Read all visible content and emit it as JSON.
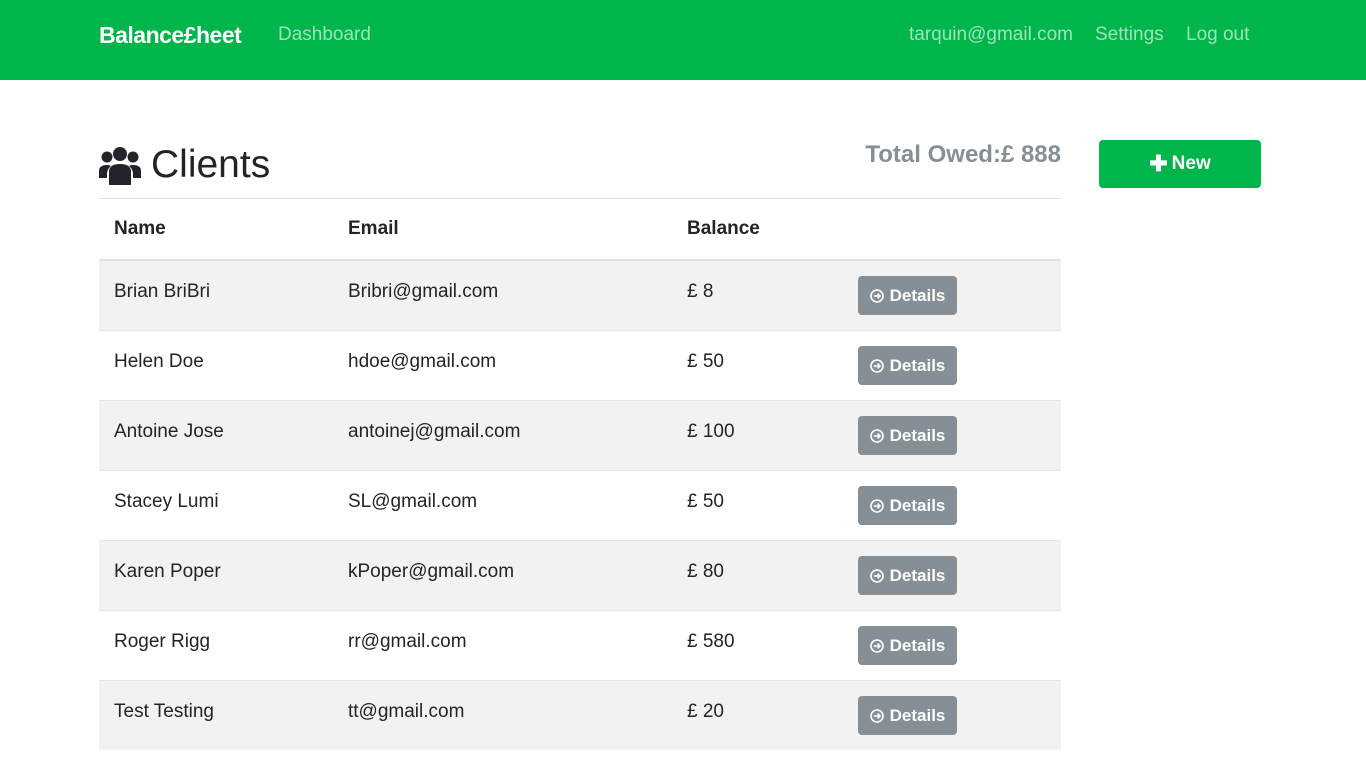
{
  "navbar": {
    "brand": "Balance£heet",
    "dashboard": "Dashboard",
    "user_email": "tarquin@gmail.com",
    "settings": "Settings",
    "logout": "Log out",
    "color": "#00b54a"
  },
  "header": {
    "title": "Clients",
    "icon": "users-icon",
    "total_owed": "Total Owed:£ 888"
  },
  "new_button": {
    "label": "New",
    "icon": "plus-icon"
  },
  "table": {
    "headers": [
      "Name",
      "Email",
      "Balance",
      ""
    ],
    "rows": [
      {
        "name": "Brian BriBri",
        "email": "Bribri@gmail.com",
        "balance": "£ 8",
        "action": "Details"
      },
      {
        "name": "Helen Doe",
        "email": "hdoe@gmail.com",
        "balance": "£ 50",
        "action": "Details"
      },
      {
        "name": "Antoine Jose",
        "email": "antoinej@gmail.com",
        "balance": "£ 100",
        "action": "Details"
      },
      {
        "name": "Stacey Lumi",
        "email": "SL@gmail.com",
        "balance": "£ 50",
        "action": "Details"
      },
      {
        "name": "Karen Poper",
        "email": "kPoper@gmail.com",
        "balance": "£ 80",
        "action": "Details"
      },
      {
        "name": "Roger Rigg",
        "email": "rr@gmail.com",
        "balance": "£ 580",
        "action": "Details"
      },
      {
        "name": "Test Testing",
        "email": "tt@gmail.com",
        "balance": "£ 20",
        "action": "Details"
      }
    ]
  },
  "colors": {
    "brand_green": "#00b54a",
    "muted_gray": "#868e96",
    "stripe": "#f2f2f2"
  }
}
